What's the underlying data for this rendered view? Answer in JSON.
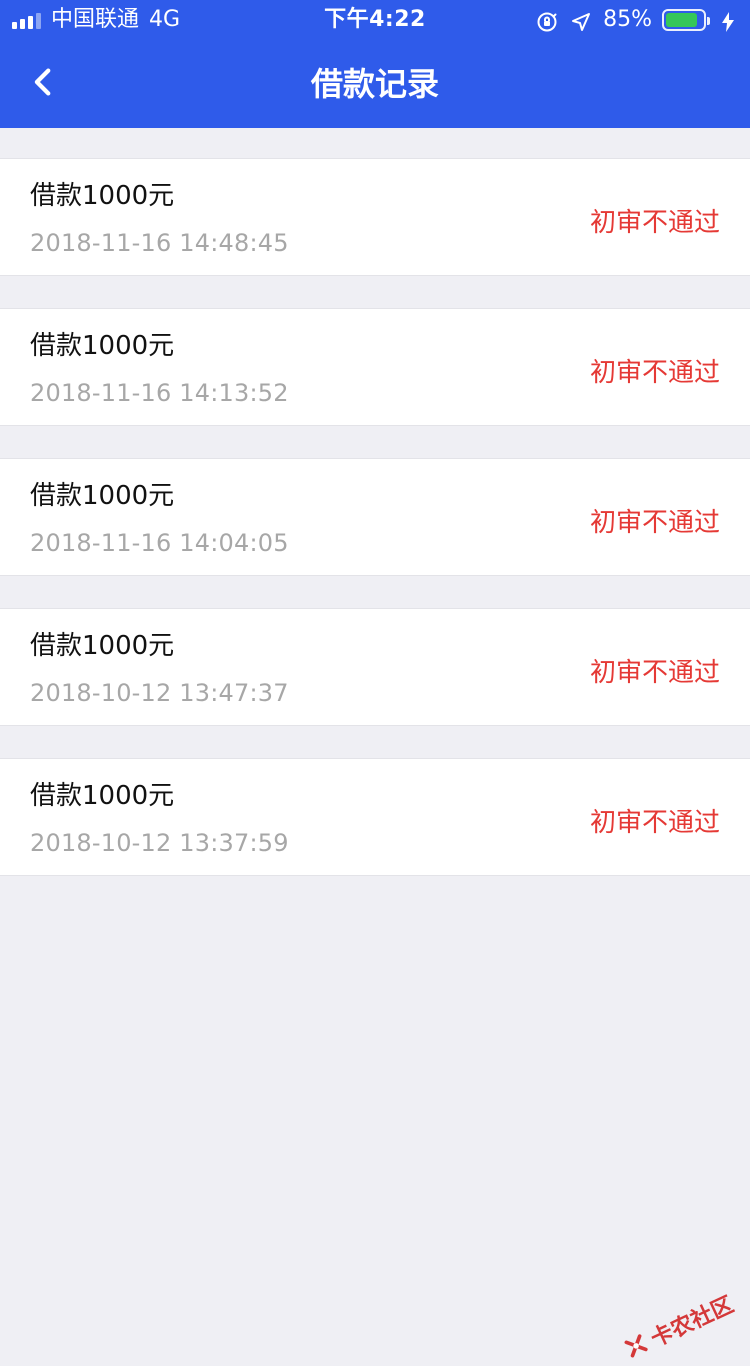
{
  "status_bar": {
    "carrier": "中国联通",
    "network": "4G",
    "time": "下午4:22",
    "battery_percent": "85%",
    "battery_level": 0.85,
    "icons": [
      "signal-icon",
      "orientation-lock-icon",
      "location-arrow-icon",
      "battery-icon",
      "charging-bolt-icon"
    ]
  },
  "nav": {
    "title": "借款记录",
    "back_icon": "chevron-left-icon"
  },
  "records": [
    {
      "amount": "借款1000元",
      "time": "2018-11-16 14:48:45",
      "status": "初审不通过"
    },
    {
      "amount": "借款1000元",
      "time": "2018-11-16 14:13:52",
      "status": "初审不通过"
    },
    {
      "amount": "借款1000元",
      "time": "2018-11-16 14:04:05",
      "status": "初审不通过"
    },
    {
      "amount": "借款1000元",
      "time": "2018-10-12 13:47:37",
      "status": "初审不通过"
    },
    {
      "amount": "借款1000元",
      "time": "2018-10-12 13:37:59",
      "status": "初审不通过"
    }
  ],
  "watermark": {
    "text": "卡农社区"
  },
  "colors": {
    "nav_bg": "#2F5BEA",
    "page_bg": "#EFEFF4",
    "status_red": "#E53935",
    "time_gray": "#A7A7A7",
    "battery_green": "#35C759"
  }
}
